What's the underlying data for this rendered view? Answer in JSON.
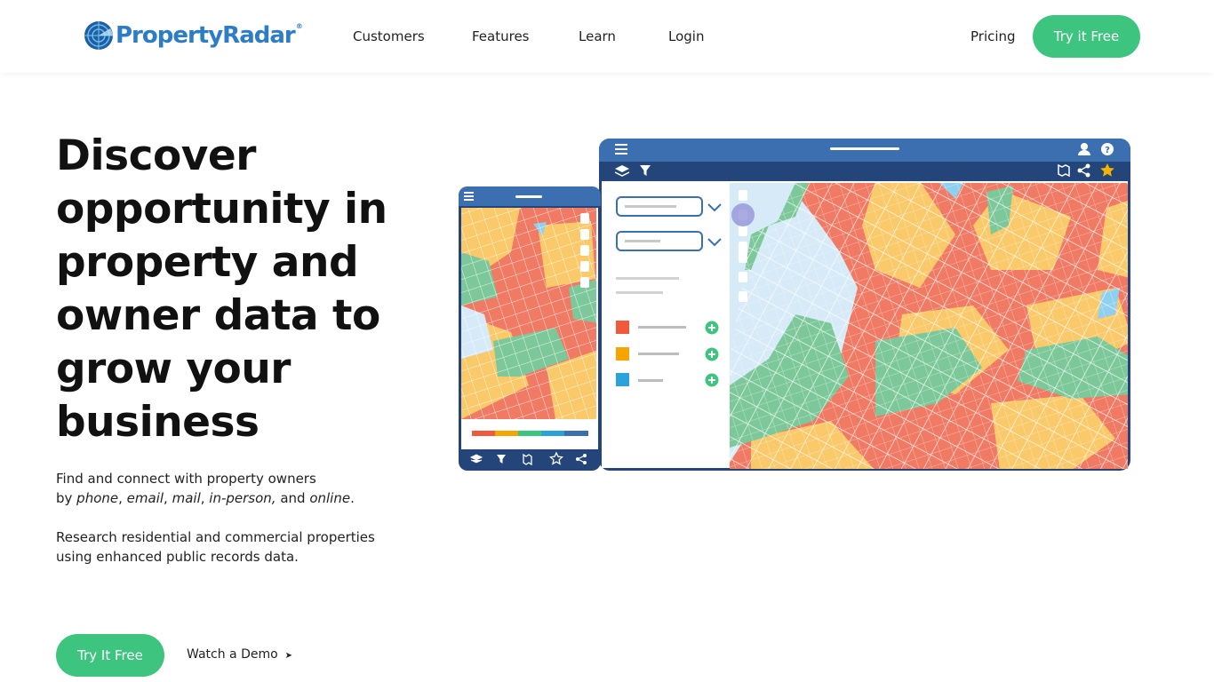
{
  "header": {
    "logo_text": "PropertyRadar",
    "logo_reg": "®",
    "nav": [
      "Customers",
      "Features",
      "Learn",
      "Login"
    ],
    "pricing": "Pricing",
    "cta": "Try it Free"
  },
  "hero": {
    "title": "Discover opportunity in property and owner data to grow your business",
    "p1_line1": "Find and connect with property owners",
    "p1_by": "by ",
    "p1_phone": "phone",
    "p1_email": "email",
    "p1_mail": "mail",
    "p1_inperson": "in-person,",
    "p1_and": " and ",
    "p1_online": "online",
    "p1_end": ".",
    "p2": "Research residential and commercial properties using enhanced public records data.",
    "cta": "Try It Free",
    "demo": "Watch a Demo",
    "demo_arrow": "➤"
  },
  "colors": {
    "brand_blue": "#2c7dc6",
    "green": "#3dc57f",
    "app_blue": "#3b6fb0",
    "app_dark": "#23457a",
    "map_red": "#f07a64",
    "map_yellow": "#f9c96a",
    "map_green": "#7dc89a",
    "map_water": "#d6eaf7",
    "legend_red": "#f05a3a",
    "legend_orange": "#f6a400",
    "legend_blue": "#2aa3dc"
  }
}
